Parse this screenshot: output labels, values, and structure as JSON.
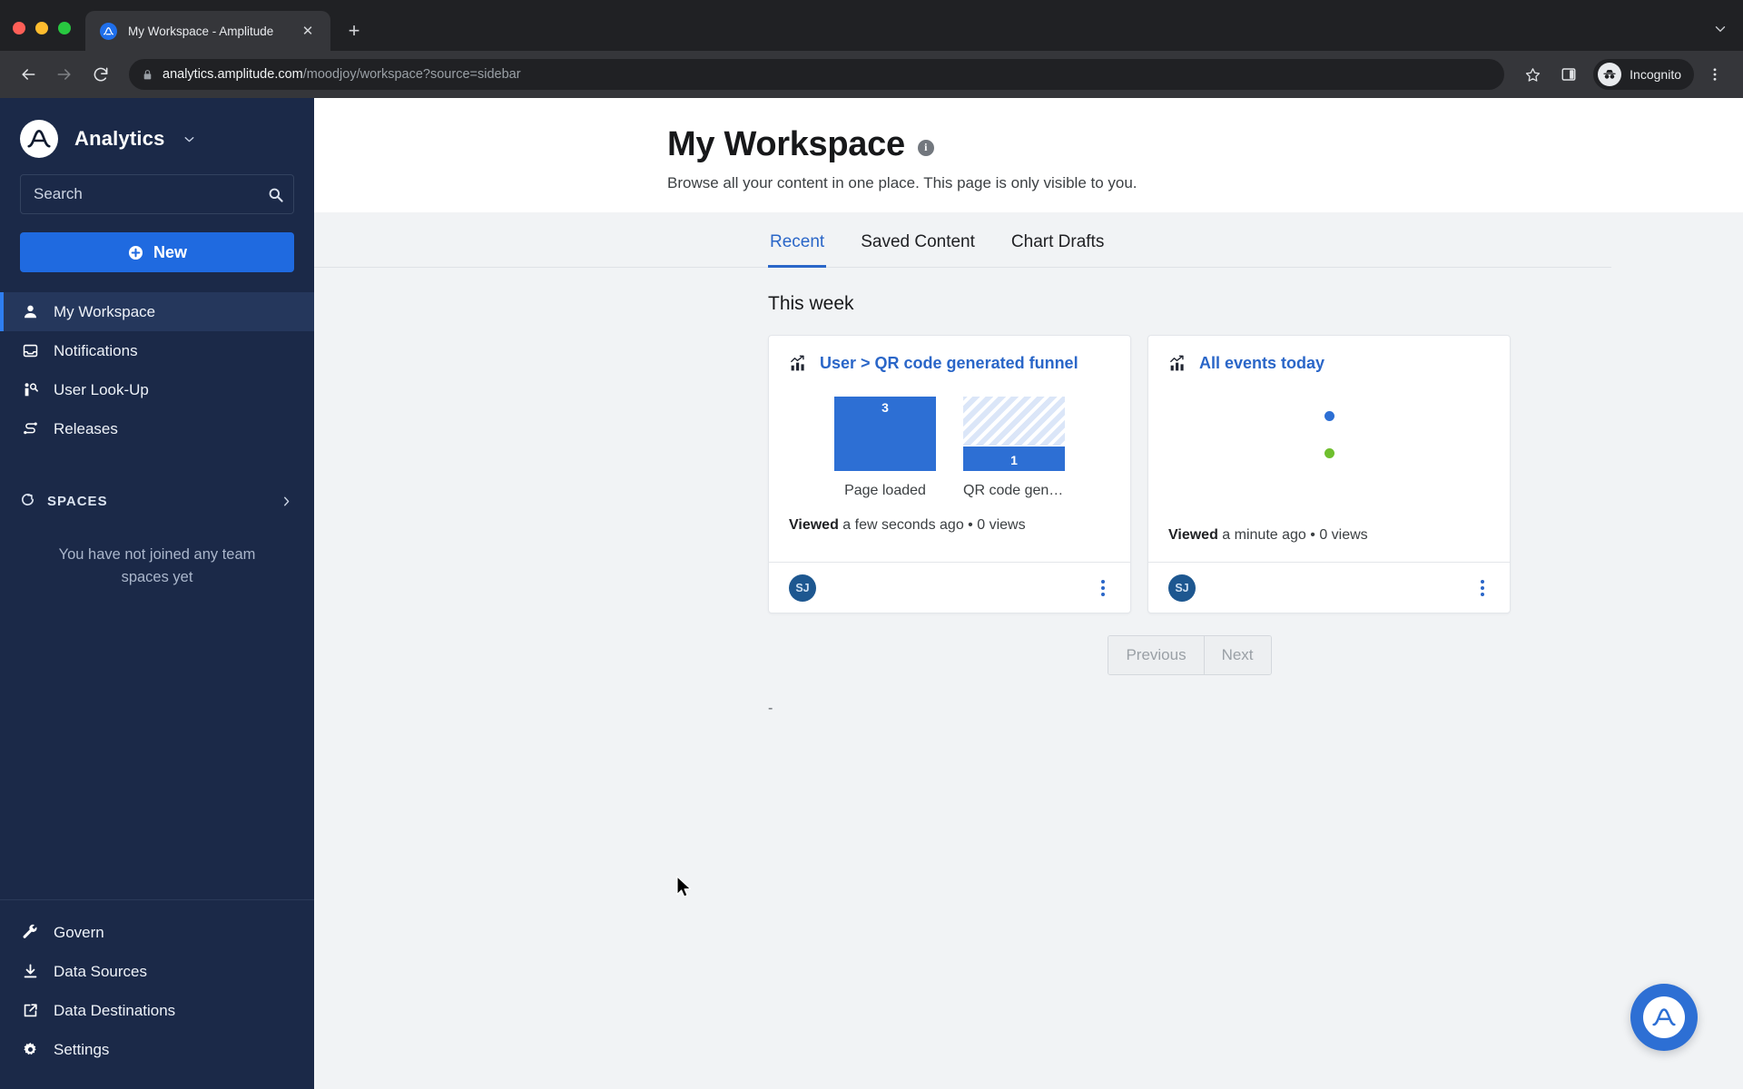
{
  "browser": {
    "tab": {
      "title": "My Workspace - Amplitude",
      "favicon_icon": "amplitude-logo-icon",
      "close_icon": "close-icon"
    },
    "new_tab_icon": "plus-icon",
    "tabstrip_menu_icon": "chevron-down-icon",
    "back_icon": "arrow-left-icon",
    "forward_icon": "arrow-right-icon",
    "reload_icon": "reload-icon",
    "url": {
      "lock_icon": "lock-icon",
      "host": "analytics.amplitude.com",
      "path": "/moodjoy/workspace?source=sidebar"
    },
    "bookmark_icon": "star-icon",
    "side_panel_icon": "side-panel-icon",
    "profile": {
      "label": "Incognito",
      "icon": "incognito-icon"
    },
    "menu_icon": "three-dots-vertical-icon"
  },
  "sidebar": {
    "brand": {
      "name": "Analytics",
      "logo_icon": "amplitude-logo-icon",
      "caret_icon": "chevron-down-icon"
    },
    "search": {
      "placeholder": "Search",
      "value": "",
      "icon": "search-icon"
    },
    "new_button": {
      "label": "New",
      "icon": "plus-circle-icon"
    },
    "nav": [
      {
        "label": "My Workspace",
        "icon": "person-icon",
        "active": true
      },
      {
        "label": "Notifications",
        "icon": "inbox-icon",
        "active": false
      },
      {
        "label": "User Look-Up",
        "icon": "person-search-icon",
        "active": false
      },
      {
        "label": "Releases",
        "icon": "releases-flow-icon",
        "active": false
      }
    ],
    "spaces": {
      "label": "SPACES",
      "icon": "spaces-icon",
      "chevron_icon": "chevron-right-icon",
      "empty_text": "You have not joined any team spaces yet"
    },
    "bottom_nav": [
      {
        "label": "Govern",
        "icon": "wrench-icon"
      },
      {
        "label": "Data Sources",
        "icon": "download-icon"
      },
      {
        "label": "Data Destinations",
        "icon": "export-icon"
      },
      {
        "label": "Settings",
        "icon": "gear-icon"
      }
    ]
  },
  "main": {
    "title": "My Workspace",
    "info_icon": "info-icon",
    "info_glyph": "i",
    "subtitle": "Browse all your content in one place. This page is only visible to you.",
    "tabs": [
      {
        "label": "Recent",
        "active": true
      },
      {
        "label": "Saved Content",
        "active": false
      },
      {
        "label": "Chart Drafts",
        "active": false
      }
    ],
    "section_label": "This week",
    "stray_text": "-",
    "pagination": {
      "previous": "Previous",
      "next": "Next"
    },
    "cards": [
      {
        "icon": "chart-icon",
        "title": "User > QR code generated funnel",
        "viewed_label": "Viewed",
        "viewed_time": "a few seconds ago",
        "separator": "•",
        "views": "0 views",
        "avatar": "SJ",
        "menu_icon": "three-dots-vertical-icon"
      },
      {
        "icon": "chart-icon",
        "title": "All events today",
        "viewed_label": "Viewed",
        "viewed_time": "a minute ago",
        "separator": "•",
        "views": "0 views",
        "avatar": "SJ",
        "menu_icon": "three-dots-vertical-icon"
      }
    ]
  },
  "fab": {
    "icon": "amplitude-logo-icon"
  },
  "colors": {
    "sidebar_bg": "#1b2948",
    "accent_blue": "#2a66c8",
    "new_button_blue": "#1f6ae0",
    "bar_solid": "#2d6fd4",
    "bar_hatch": "#dbe6f8",
    "scatter_blue": "#2d6fd4",
    "scatter_green": "#6fbf2e",
    "avatar_bg": "#1d5790",
    "content_bg": "#f1f3f5"
  },
  "chart_data": [
    {
      "type": "bar",
      "title": "User > QR code generated funnel",
      "categories": [
        "Page loaded",
        "QR code generat..."
      ],
      "values": [
        3,
        1
      ],
      "value_labels": [
        "3",
        "1"
      ],
      "ylim": [
        0,
        3
      ],
      "xlabel": "",
      "ylabel": "",
      "grid": false,
      "legend": "none",
      "notes": "Funnel chart: first step full solid bar value 3; second step solid portion value 1 with hatched remainder representing drop-off"
    },
    {
      "type": "scatter",
      "title": "All events today",
      "series": [
        {
          "name": "series-1",
          "color": "#2d6fd4",
          "points": [
            [
              0.5,
              0.72
            ]
          ]
        },
        {
          "name": "series-2",
          "color": "#6fbf2e",
          "points": [
            [
              0.5,
              0.45
            ]
          ]
        }
      ],
      "xlabel": "",
      "ylabel": "",
      "grid": false,
      "legend": "none",
      "notes": "Two single data points rendered as dots, no axes or labels visible"
    }
  ]
}
